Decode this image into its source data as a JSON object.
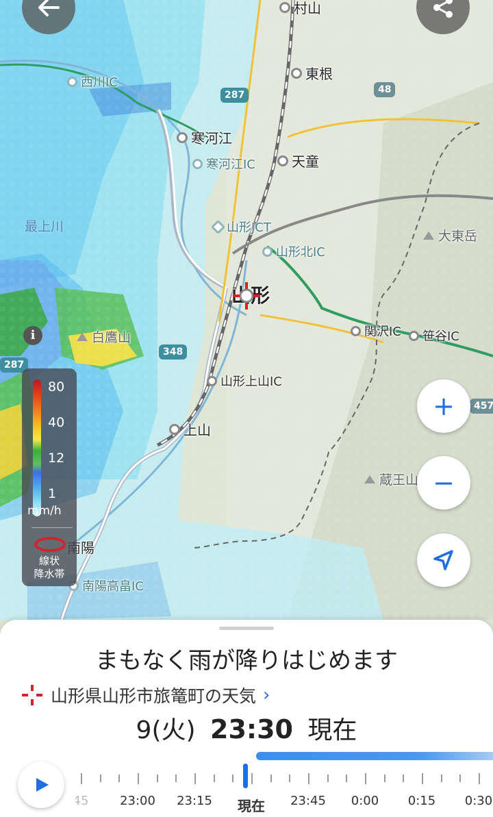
{
  "colors": {
    "accent": "#1f6fe0",
    "rain_cursor": "#d8202a",
    "sheet_bg": "#ffffff"
  },
  "top_bar": {
    "back_icon": "arrow-left-icon",
    "share_icon": "share-icon"
  },
  "map": {
    "places": [
      {
        "name": "村山",
        "kind": "city"
      },
      {
        "name": "東根",
        "kind": "city"
      },
      {
        "name": "西川IC",
        "kind": "ic"
      },
      {
        "name": "寒河江",
        "kind": "city"
      },
      {
        "name": "寒河江IC",
        "kind": "ic"
      },
      {
        "name": "天童",
        "kind": "city"
      },
      {
        "name": "山形JCT",
        "kind": "jct"
      },
      {
        "name": "山形北IC",
        "kind": "ic"
      },
      {
        "name": "大東岳",
        "kind": "mountain"
      },
      {
        "name": "最上川",
        "kind": "river"
      },
      {
        "name": "山形",
        "kind": "selected"
      },
      {
        "name": "白鷹山",
        "kind": "mountain"
      },
      {
        "name": "関沢IC",
        "kind": "ic"
      },
      {
        "name": "笹谷IC",
        "kind": "ic"
      },
      {
        "name": "山形上山IC",
        "kind": "ic"
      },
      {
        "name": "上山",
        "kind": "city"
      },
      {
        "name": "蔵王山",
        "kind": "mountain"
      },
      {
        "name": "南陽",
        "kind": "city"
      },
      {
        "name": "南陽高畠IC",
        "kind": "ic"
      }
    ],
    "route_shields": [
      "287",
      "48",
      "348",
      "287",
      "457"
    ],
    "legend": {
      "values": [
        "80",
        "40",
        "12",
        "1"
      ],
      "unit": "mm/h",
      "band_label": "線状\n降水帯"
    },
    "controls": {
      "zoom_in": "+",
      "zoom_out": "−",
      "locate_icon": "navigation-arrow-icon",
      "info": "i"
    }
  },
  "sheet": {
    "headline": "まもなく雨が降りはじめます",
    "location": "山形県山形市旅篭町の天気",
    "time_day": "9(火)",
    "time_clock": "23:30",
    "time_suffix": "現在",
    "timeline": {
      "labels": [
        "45",
        "23:00",
        "23:15",
        "現在",
        "23:45",
        "0:00",
        "0:15",
        "0:30"
      ],
      "current_label": "現在"
    },
    "forecast_progress_pct": 48
  }
}
